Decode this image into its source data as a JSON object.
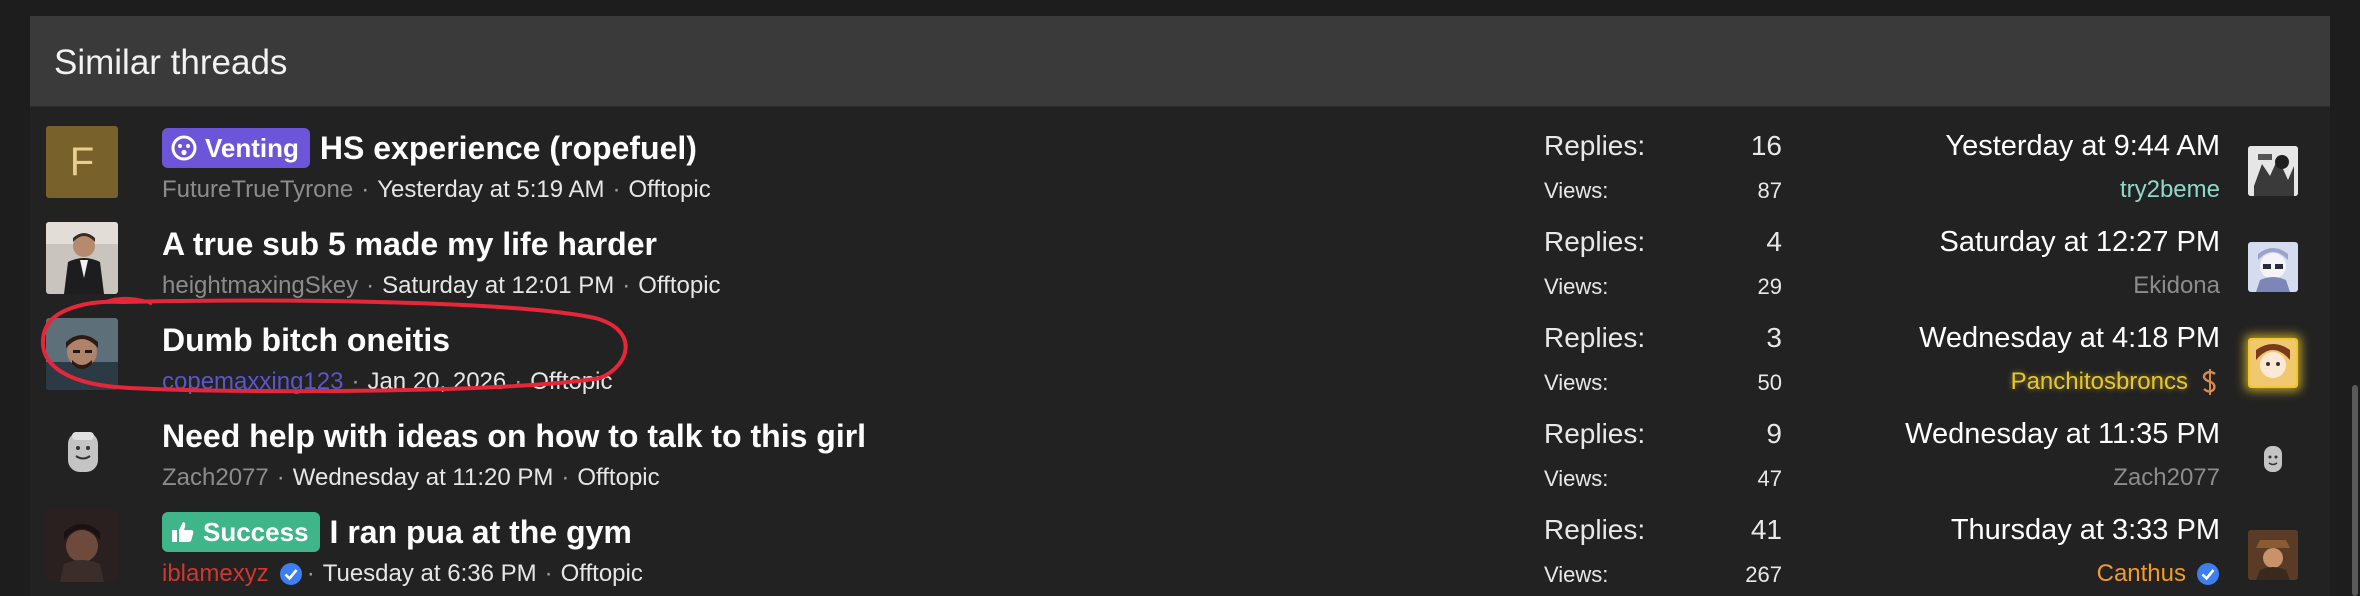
{
  "header": {
    "title": "Similar threads"
  },
  "stat_labels": {
    "replies": "Replies:",
    "views": "Views:"
  },
  "threads": [
    {
      "avatar_letter": "F",
      "prefix": {
        "label": "Venting",
        "color": "#6d55d9",
        "icon": "venting-icon"
      },
      "title": "HS experience (ropefuel)",
      "author": "FutureTrueTyrone",
      "author_color": "#8c8c8c",
      "date": "Yesterday at 5:19 AM",
      "forum": "Offtopic",
      "replies": "16",
      "views": "87",
      "last_date": "Yesterday at 9:44 AM",
      "last_user": "try2beme",
      "last_user_color": "#8fd9c9"
    },
    {
      "title": "A true sub 5 made my life harder",
      "author": "heightmaxingSkey",
      "author_color": "#8c8c8c",
      "date": "Saturday at 12:01 PM",
      "forum": "Offtopic",
      "replies": "4",
      "views": "29",
      "last_date": "Saturday at 12:27 PM",
      "last_user": "Ekidona",
      "last_user_color": "#8c8c8c"
    },
    {
      "title": "Dumb bitch oneitis",
      "author": "copemaxxing123",
      "author_color": "#5b56c9",
      "date": "Jan 20, 2026",
      "forum": "Offtopic",
      "replies": "3",
      "views": "50",
      "last_date": "Wednesday at 4:18 PM",
      "last_user": "Panchitosbroncs",
      "last_user_color": "#e8c72e",
      "last_user_badge": "dollar-icon"
    },
    {
      "title": "Need help with ideas on how to talk to this girl",
      "author": "Zach2077",
      "author_color": "#8c8c8c",
      "date": "Wednesday at 11:20 PM",
      "forum": "Offtopic",
      "replies": "9",
      "views": "47",
      "last_date": "Wednesday at 11:35 PM",
      "last_user": "Zach2077",
      "last_user_color": "#8c8c8c"
    },
    {
      "prefix": {
        "label": "Success",
        "color": "#3fb58a",
        "icon": "thumbs-up-icon"
      },
      "title": "I ran pua at the gym",
      "author": "iblamexyz",
      "author_color": "#d2362d",
      "author_badge": "verified-icon",
      "date": "Tuesday at 6:36 PM",
      "forum": "Offtopic",
      "replies": "41",
      "views": "267",
      "last_date": "Thursday at 3:33 PM",
      "last_user": "Canthus",
      "last_user_color": "#f39b2a",
      "last_user_badge": "verified-icon"
    }
  ],
  "colors": {
    "header_bg": "#3a3a3a",
    "panel_bg": "#222222",
    "annotation": "#e8263a",
    "verified": "#3d7ef0"
  }
}
